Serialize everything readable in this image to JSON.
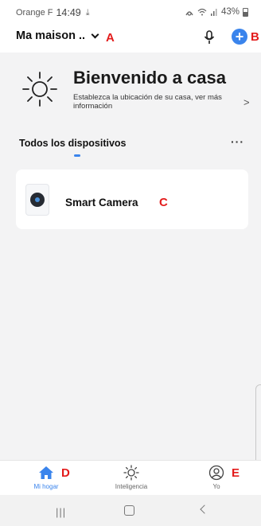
{
  "status_bar": {
    "carrier": "Orange F",
    "time": "14:49",
    "download_icon": "⤓",
    "battery": "43%",
    "icons": [
      "alarm-icon",
      "wifi-icon",
      "signal-icon",
      "battery-icon"
    ]
  },
  "header": {
    "home_name": "Ma maison ..",
    "mic_icon": "microphone-icon",
    "add_icon": "plus-circle-icon",
    "add_symbol": "+"
  },
  "welcome": {
    "title": "Bienvenido a casa",
    "subtitle": "Establezca la ubicación de su casa, ver más información",
    "arrow": ">"
  },
  "devices_section": {
    "title": "Todos los dispositivos",
    "more": "···"
  },
  "devices": [
    {
      "name": "Smart Camera",
      "icon": "camera-icon"
    }
  ],
  "tabbar": [
    {
      "label": "Mi hogar",
      "icon": "home-icon",
      "active": true
    },
    {
      "label": "Inteligencia",
      "icon": "sun-icon",
      "active": false
    },
    {
      "label": "Yo",
      "icon": "user-icon",
      "active": false
    }
  ],
  "navbar": {
    "recents": "|||",
    "home": "home-button",
    "back": "back-button"
  },
  "annotations": {
    "a": "A",
    "b": "B",
    "c": "C",
    "d": "D",
    "e": "E"
  },
  "colors": {
    "accent": "#3a84ec",
    "annotation": "#e31b1b",
    "background": "#f3f3f4"
  }
}
